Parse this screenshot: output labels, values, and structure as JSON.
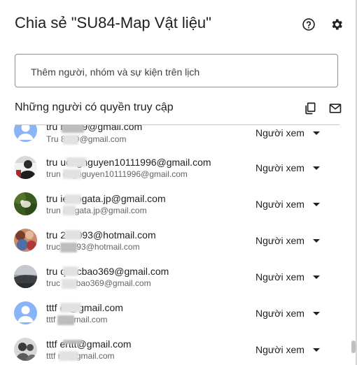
{
  "dialog": {
    "title": "Chia sẻ \"SU84-Map Vật liệu\"",
    "help_icon": "help-circle-icon",
    "settings_icon": "gear-icon"
  },
  "add_people": {
    "placeholder": "Thêm người, nhóm và sự kiện trên lịch",
    "value": ""
  },
  "access": {
    "title": "Những người có quyền truy cập",
    "copy_icon": "copy-icon",
    "email_icon": "mail-icon"
  },
  "people": [
    {
      "email": "tru        n8989@gmail.com",
      "sub": "Tru        8989@gmail.com",
      "role": "Người xem",
      "avatar": "default-person-avatar"
    },
    {
      "email": "tru       uongnguyen10111996@gmail.com",
      "sub": "trun       ongnguyen10111996@gmail.com",
      "role": "Người xem",
      "avatar": "photo-avatar"
    },
    {
      "email": "tru       ien.ogata.jp@gmail.com",
      "sub": "trun       n.ogata.jp@gmail.com",
      "role": "Người xem",
      "avatar": "photo-avatar"
    },
    {
      "email": "tru       201093@hotmail.com",
      "sub": "truc       01093@hotmail.com",
      "role": "Người xem",
      "avatar": "photo-avatar"
    },
    {
      "email": "tru       quocbao369@gmail.com",
      "sub": "truc       uocbao369@gmail.com",
      "role": "Người xem",
      "avatar": "photo-avatar"
    },
    {
      "email": "tttf       er@gmail.com",
      "sub": "tttf       r@gmail.com",
      "role": "Người xem",
      "avatar": "default-person-avatar"
    },
    {
      "email": "tttf       erttt@gmail.com",
      "sub": "tttf       rttt@gmail.com",
      "role": "Người xem",
      "avatar": "photo-avatar"
    }
  ],
  "colors": {
    "default_avatar_bg": "#8ab4f8",
    "default_avatar_fg": "#ffffff",
    "text_primary": "#202124",
    "text_secondary": "#5f6368"
  }
}
